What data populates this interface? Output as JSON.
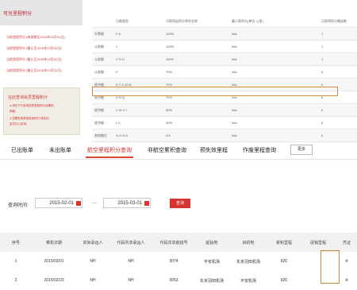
{
  "left_panel": {
    "title": "可兑里程积分",
    "links": [
      "当前里程积分 (有效期至2016年12月31日)",
      "当前里程积分 (截止至2016年12月31日)",
      "当前里程积分 (截止至2016年12月31日)",
      "当前里程积分 (截止至2016年12月31日)"
    ],
    "info_title": "在此查询会员里程积分",
    "info_lines": [
      "● 请在下方查询您的里程积分及累积",
      "  明细。",
      "● 如需查询其他航段积分,请前往",
      "  会员中心查询。"
    ]
  },
  "upper_table": {
    "headers": [
      "",
      "日期类型",
      "可获得返积分率的名称",
      "最小获积分(单位:公里)",
      "可获得积分赠送数"
    ],
    "rows": [
      [
        "头等舱",
        "F A",
        "120%",
        "N/A",
        "1"
      ],
      [
        "公务舱",
        "J",
        "120%",
        "N/A",
        "1"
      ],
      [
        "公务舱",
        "C R D",
        "110%",
        "N/A",
        "1"
      ],
      [
        "公务舱",
        "F",
        "70%",
        "N/A",
        "0"
      ],
      [
        "经济舱",
        "D T S W M",
        "70%",
        "N/A",
        "0"
      ],
      [
        "经济舱",
        "U R Q",
        "70%",
        "N/A",
        "0"
      ],
      [
        "经济舱",
        "V W X T",
        "50%",
        "N/A",
        "0"
      ],
      [
        "经济舱",
        "L K",
        "30%",
        "N/A",
        "0"
      ],
      [
        "其他舱位",
        "G H N S",
        "0%",
        "N/A",
        "0"
      ]
    ]
  },
  "tabs": [
    "已出账单",
    "未出账单",
    "航空里程积分查询",
    "非航空累积查询",
    "预失效里程",
    "作废里程查询"
  ],
  "more_label": "更多",
  "query": {
    "label": "查询时间:",
    "start": "2015-02-01",
    "end": "2015-03-01",
    "sep": "—",
    "button": "查询"
  },
  "bottom_table": {
    "headers": [
      "序号",
      "乘机日期",
      "实际承运人",
      "代码共享承运人",
      "代码共享航班号",
      "起始地",
      "目的地",
      "累积里程",
      "促销里程",
      "凭证"
    ],
    "rows": [
      [
        "1",
        "2015/03/01",
        "NH",
        "NH",
        "0074",
        "平安机场",
        "东京羽田机场",
        "820",
        "",
        "※"
      ],
      [
        "2",
        "2015/02/23",
        "NH",
        "NH",
        "0053",
        "东京羽田机场",
        "平安机场",
        "820",
        "",
        "※"
      ]
    ]
  },
  "colors": {
    "accent": "#d7342f",
    "highlight": "#cc8a3c"
  }
}
